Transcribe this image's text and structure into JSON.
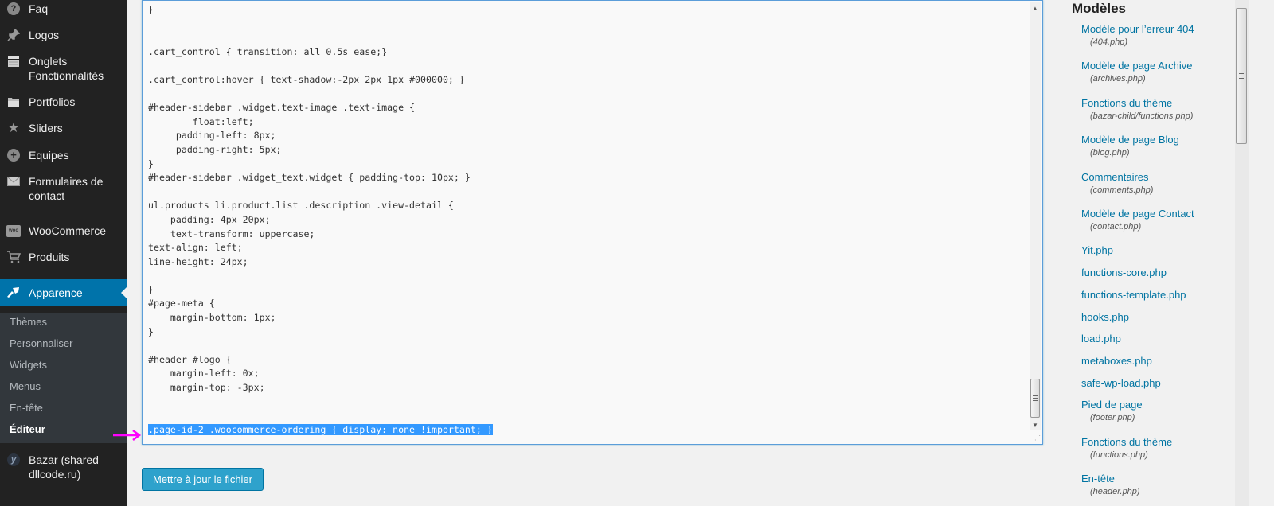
{
  "sidebar": {
    "items": [
      {
        "label": "Faq",
        "icon": "question-circle-icon"
      },
      {
        "label": "Logos",
        "icon": "pin-icon"
      },
      {
        "label": "Onglets Fonctionnalités",
        "icon": "tabs-icon"
      },
      {
        "label": "Portfolios",
        "icon": "folder-icon"
      },
      {
        "label": "Sliders",
        "icon": "star-icon"
      },
      {
        "label": "Equipes",
        "icon": "plus-circle-icon"
      },
      {
        "label": "Formulaires de contact",
        "icon": "mail-icon"
      },
      {
        "label": "WooCommerce",
        "icon": "woocommerce-icon"
      },
      {
        "label": "Produits",
        "icon": "cart-icon"
      },
      {
        "label": "Apparence",
        "icon": "paintbrush-icon",
        "active": true
      },
      {
        "label": "Bazar (shared dllcode.ru)",
        "icon": "yit-icon"
      }
    ],
    "submenu": [
      "Thèmes",
      "Personnaliser",
      "Widgets",
      "Menus",
      "En-tête",
      "Éditeur"
    ],
    "current_submenu": "Éditeur",
    "accent_color": "#0073aa"
  },
  "editor": {
    "lines": [
      "}",
      "",
      "",
      ".cart_control { transition: all 0.5s ease;}",
      "",
      ".cart_control:hover { text-shadow:-2px 2px 1px #000000; }",
      "",
      "#header-sidebar .widget.text-image .text-image {",
      "        float:left;",
      "     padding-left: 8px;",
      "     padding-right: 5px;",
      "}",
      "#header-sidebar .widget_text.widget { padding-top: 10px; }",
      "",
      "ul.products li.product.list .description .view-detail {",
      "    padding: 4px 20px;",
      "    text-transform: uppercase;",
      "text-align: left;",
      "line-height: 24px;",
      "",
      "}",
      "#page-meta {",
      "    margin-bottom: 1px;",
      "}",
      "",
      "#header #logo {",
      "    margin-left: 0x;",
      "    margin-top: -3px;",
      "",
      "",
      ".page-id-2 .woocommerce-ordering { display: none !important; }"
    ],
    "selected_line_index": 30,
    "selection_color": "#3399ff"
  },
  "update_button": {
    "label": "Mettre à jour le fichier",
    "color": "#2ea2cc"
  },
  "templates": {
    "heading": "Modèles",
    "items": [
      {
        "name": "Modèle pour l’erreur 404",
        "file": "(404.php)"
      },
      {
        "name": "Modèle de page Archive",
        "file": "(archives.php)"
      },
      {
        "name": "Fonctions du thème",
        "file": "(bazar-child/functions.php)"
      },
      {
        "name": "Modèle de page Blog",
        "file": "(blog.php)"
      },
      {
        "name": "Commentaires",
        "file": "(comments.php)"
      },
      {
        "name": "Modèle de page Contact",
        "file": "(contact.php)"
      },
      {
        "name": "Yit.php",
        "file": ""
      },
      {
        "name": "functions-core.php",
        "file": ""
      },
      {
        "name": "functions-template.php",
        "file": ""
      },
      {
        "name": "hooks.php",
        "file": ""
      },
      {
        "name": "load.php",
        "file": ""
      },
      {
        "name": "metaboxes.php",
        "file": ""
      },
      {
        "name": "safe-wp-load.php",
        "file": ""
      },
      {
        "name": "Pied de page",
        "file": "(footer.php)"
      },
      {
        "name": "Fonctions du thème",
        "file": "(functions.php)"
      },
      {
        "name": "En-tête",
        "file": "(header.php)"
      }
    ],
    "link_color": "#0074a2"
  },
  "annotation": {
    "arrow_color": "#ff00ff"
  }
}
